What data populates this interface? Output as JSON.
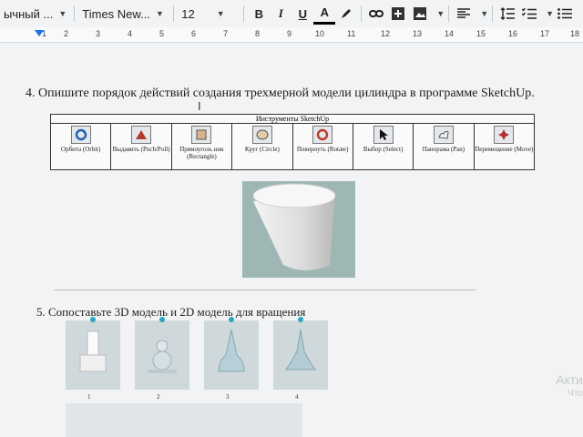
{
  "toolbar": {
    "style_label": "ычный ...",
    "font_label": "Times New...",
    "size_label": "12",
    "bold": "B",
    "italic": "I",
    "underline": "U",
    "text_color": "A"
  },
  "ruler": {
    "numbers": [
      "1",
      "2",
      "3",
      "4",
      "5",
      "6",
      "7",
      "8",
      "9",
      "10",
      "11",
      "12",
      "13",
      "14",
      "15",
      "16",
      "17",
      "18"
    ]
  },
  "question4": {
    "text": "4.   Опишите порядок действий создания трехмерной модели цилиндра в программе SketchUp."
  },
  "tools_table": {
    "title": "Инструменты SketchUp",
    "items": [
      {
        "label": "Орбита (Orbit)",
        "icon": "orbit-icon"
      },
      {
        "label": "Выдавить (Puch/Poll)",
        "icon": "pushpull-icon"
      },
      {
        "label": "Прямоуголь ник (Rectangle)",
        "icon": "rectangle-icon"
      },
      {
        "label": "Круг (Circle)",
        "icon": "circle-icon"
      },
      {
        "label": "Повернуть (Rotate)",
        "icon": "rotate-icon"
      },
      {
        "label": "Выбор (Select)",
        "icon": "select-icon"
      },
      {
        "label": "Панорама (Pan)",
        "icon": "pan-icon"
      },
      {
        "label": "Перемещение (Move)",
        "icon": "move-icon"
      }
    ]
  },
  "question5": {
    "text": "5.   Сопоставьте 3D модель и 2D модель для вращения"
  },
  "models": [
    {
      "num": "1"
    },
    {
      "num": "2"
    },
    {
      "num": "3"
    },
    {
      "num": "4"
    }
  ],
  "watermark": {
    "line1": "Акти",
    "line2": "Что"
  },
  "colors": {
    "accent": "#1a73e8",
    "pin": "#2aa7b8"
  }
}
